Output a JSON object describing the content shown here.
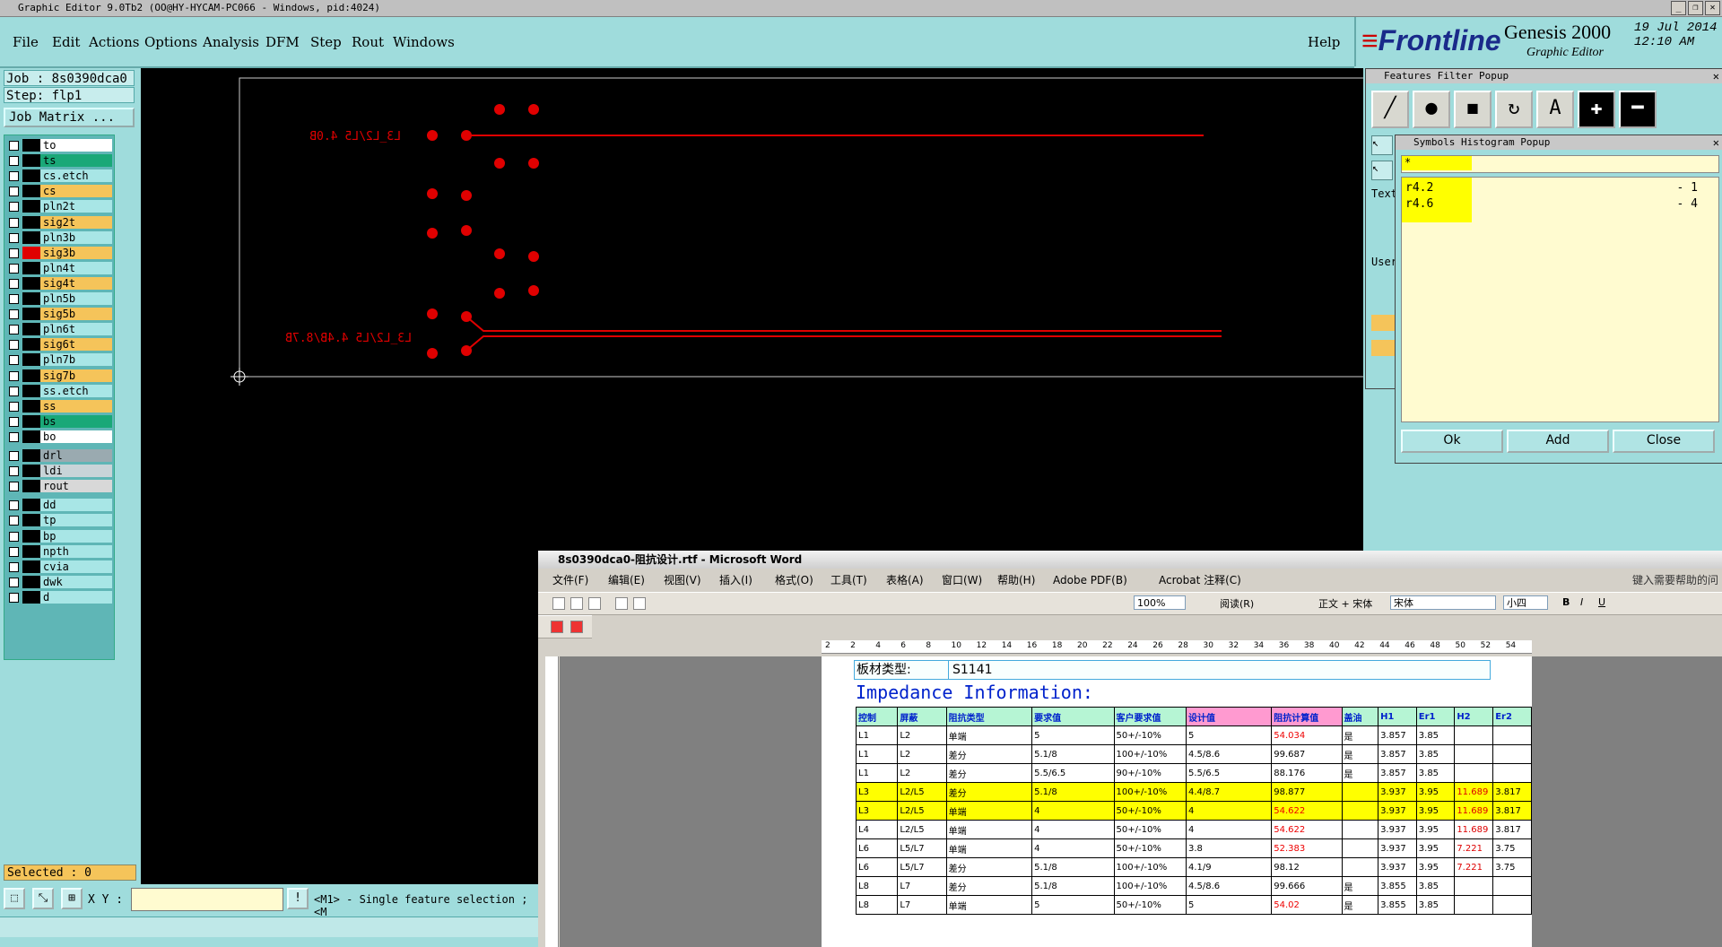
{
  "window": {
    "title": "Graphic Editor 9.0Tb2 (OO@HY-HYCAM-PC066 - Windows, pid:4024)"
  },
  "menu": {
    "items": [
      "File",
      "Edit",
      "Actions",
      "Options",
      "Analysis",
      "DFM",
      "Step",
      "Rout",
      "Windows"
    ],
    "help": "Help"
  },
  "brand": {
    "logo": "Frontline",
    "product": "Genesis 2000",
    "subtitle": "Graphic Editor",
    "date": "19 Jul 2014",
    "time": "12:10 AM"
  },
  "job": {
    "job_label": "Job : 8s0390dca0",
    "step_label": "Step: flp1",
    "matrix_button": "Job Matrix ..."
  },
  "layers": [
    {
      "name": "to",
      "color": "#ffffff"
    },
    {
      "name": "ts",
      "color": "#1aa878"
    },
    {
      "name": "cs.etch",
      "color": "#a8e6e6"
    },
    {
      "name": "cs",
      "color": "#f5c45a"
    },
    {
      "name": "pln2t",
      "color": "#a8e6e6"
    },
    {
      "name": "sig2t",
      "color": "#f5c45a"
    },
    {
      "name": "pln3b",
      "color": "#a8e6e6"
    },
    {
      "name": "sig3b",
      "color": "#f5c45a",
      "active": true
    },
    {
      "name": "pln4t",
      "color": "#a8e6e6"
    },
    {
      "name": "sig4t",
      "color": "#f5c45a"
    },
    {
      "name": "pln5b",
      "color": "#a8e6e6"
    },
    {
      "name": "sig5b",
      "color": "#f5c45a"
    },
    {
      "name": "pln6t",
      "color": "#a8e6e6"
    },
    {
      "name": "sig6t",
      "color": "#f5c45a"
    },
    {
      "name": "pln7b",
      "color": "#a8e6e6"
    },
    {
      "name": "sig7b",
      "color": "#f5c45a"
    },
    {
      "name": "ss.etch",
      "color": "#a8e6e6"
    },
    {
      "name": "ss",
      "color": "#f5c45a"
    },
    {
      "name": "bs",
      "color": "#1aa878"
    },
    {
      "name": "bo",
      "color": "#ffffff"
    },
    {
      "name": "drl",
      "color": "#9aaab0"
    },
    {
      "name": "ldi",
      "color": "#c8d4d8"
    },
    {
      "name": "rout",
      "color": "#d8d8d8"
    },
    {
      "name": "dd",
      "color": "#a8e6e6"
    },
    {
      "name": "tp",
      "color": "#a8e6e6"
    },
    {
      "name": "bp",
      "color": "#a8e6e6"
    },
    {
      "name": "npth",
      "color": "#a8e6e6"
    },
    {
      "name": "cvia",
      "color": "#a8e6e6"
    },
    {
      "name": "dwk",
      "color": "#a8e6e6"
    },
    {
      "name": "d",
      "color": "#a8e6e6"
    }
  ],
  "status": {
    "selected": "Selected : 0",
    "xy_label": "X Y :",
    "message": "<M1> - Single feature selection ; <M"
  },
  "canvas": {
    "label1": "L3_L2/L5 4.0B",
    "label2": "L3_L2/L5 4.4B/8.7B",
    "trace_color": "#e00000"
  },
  "features_filter": {
    "title": "Features Filter Popup",
    "tool_icons": [
      "line-icon",
      "pad-icon",
      "surface-icon",
      "arc-icon",
      "text-icon",
      "plus-icon",
      "minus-icon"
    ],
    "side_text": "Text",
    "side_user": "User"
  },
  "symbols_histogram": {
    "title": "Symbols Histogram Popup",
    "filter": "*",
    "rows": [
      {
        "symbol": "r4.2",
        "count": "- 1"
      },
      {
        "symbol": "r4.6",
        "count": "- 4"
      }
    ],
    "buttons": {
      "ok": "Ok",
      "add": "Add",
      "close": "Close"
    }
  },
  "word": {
    "title": "8s0390dca0-阻抗设计.rtf - Microsoft Word",
    "menu": [
      "文件(F)",
      "编辑(E)",
      "视图(V)",
      "插入(I)",
      "格式(O)",
      "工具(T)",
      "表格(A)",
      "窗口(W)",
      "帮助(H)",
      "Adobe PDF(B)",
      "Acrobat 注释(C)"
    ],
    "help_hint": "键入需要帮助的问",
    "toolbar": {
      "zoom": "100%",
      "read": "阅读(R)",
      "style": "正文 + 宋体",
      "font": "宋体",
      "size": "小四"
    },
    "ruler_ticks": [
      "2",
      "2",
      "4",
      "6",
      "8",
      "10",
      "12",
      "14",
      "16",
      "18",
      "20",
      "22",
      "24",
      "26",
      "28",
      "30",
      "32",
      "34",
      "36",
      "38",
      "40",
      "42",
      "44",
      "46",
      "48",
      "50",
      "52",
      "54"
    ],
    "board_label": "板材类型:",
    "board_value": "S1141",
    "heading": "Impedance Information:",
    "table_headers": [
      "控制",
      "屏蔽",
      "阻抗类型",
      "要求值",
      "客户要求值",
      "设计值",
      "阻抗计算值",
      "盖油",
      "H1",
      "Er1",
      "H2",
      "Er2"
    ],
    "table_rows": [
      {
        "cells": [
          "L1",
          "L2",
          "单端",
          "5",
          "50+/-10%",
          "5",
          "54.034",
          "是",
          "3.857",
          "3.85",
          "",
          ""
        ],
        "hl": false
      },
      {
        "cells": [
          "L1",
          "L2",
          "差分",
          "5.1/8",
          "100+/-10%",
          "4.5/8.6",
          "99.687",
          "是",
          "3.857",
          "3.85",
          "",
          ""
        ],
        "hl": false
      },
      {
        "cells": [
          "L1",
          "L2",
          "差分",
          "5.5/6.5",
          "90+/-10%",
          "5.5/6.5",
          "88.176",
          "是",
          "3.857",
          "3.85",
          "",
          ""
        ],
        "hl": false
      },
      {
        "cells": [
          "L3",
          "L2/L5",
          "差分",
          "5.1/8",
          "100+/-10%",
          "4.4/8.7",
          "98.877",
          "",
          "3.937",
          "3.95",
          "11.689",
          "3.817"
        ],
        "hl": true
      },
      {
        "cells": [
          "L3",
          "L2/L5",
          "单端",
          "4",
          "50+/-10%",
          "4",
          "54.622",
          "",
          "3.937",
          "3.95",
          "11.689",
          "3.817"
        ],
        "hl": true
      },
      {
        "cells": [
          "L4",
          "L2/L5",
          "单端",
          "4",
          "50+/-10%",
          "4",
          "54.622",
          "",
          "3.937",
          "3.95",
          "11.689",
          "3.817"
        ],
        "hl": false
      },
      {
        "cells": [
          "L6",
          "L5/L7",
          "单端",
          "4",
          "50+/-10%",
          "3.8",
          "52.383",
          "",
          "3.937",
          "3.95",
          "7.221",
          "3.75"
        ],
        "hl": false
      },
      {
        "cells": [
          "L6",
          "L5/L7",
          "差分",
          "5.1/8",
          "100+/-10%",
          "4.1/9",
          "98.12",
          "",
          "3.937",
          "3.95",
          "7.221",
          "3.75"
        ],
        "hl": false
      },
      {
        "cells": [
          "L8",
          "L7",
          "差分",
          "5.1/8",
          "100+/-10%",
          "4.5/8.6",
          "99.666",
          "是",
          "3.855",
          "3.85",
          "",
          ""
        ],
        "hl": false
      },
      {
        "cells": [
          "L8",
          "L7",
          "单端",
          "5",
          "50+/-10%",
          "5",
          "54.02",
          "是",
          "3.855",
          "3.85",
          "",
          ""
        ],
        "hl": false
      }
    ]
  }
}
